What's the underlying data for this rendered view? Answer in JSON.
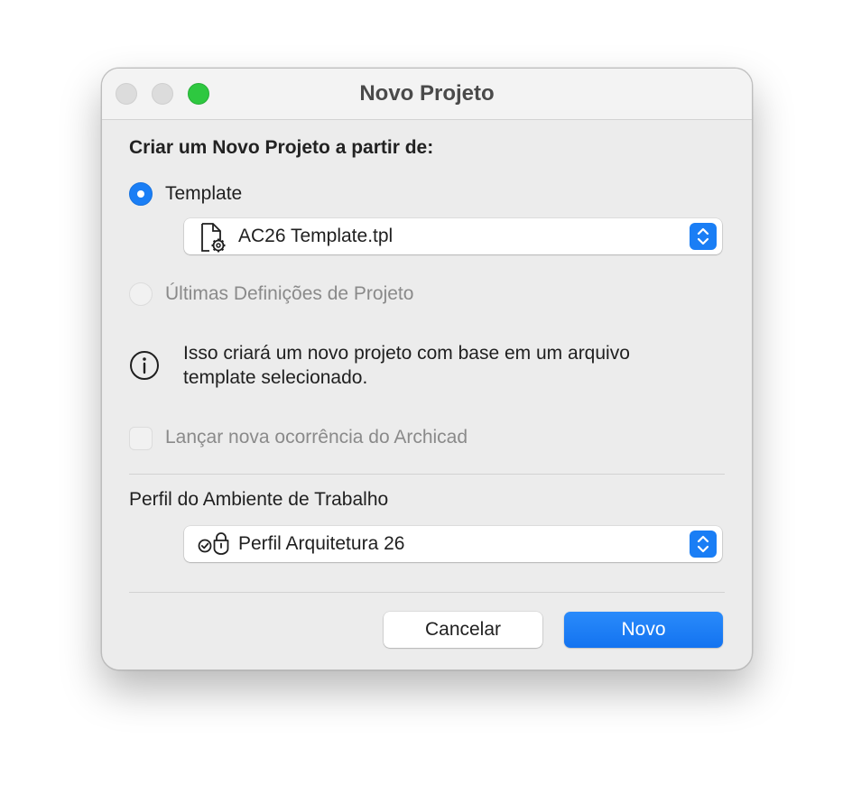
{
  "window": {
    "title": "Novo Projeto"
  },
  "source": {
    "heading": "Criar um Novo Projeto a partir de:",
    "template_option": {
      "label": "Template",
      "selected": true
    },
    "template_popup": {
      "value": "AC26 Template.tpl",
      "icon": "template-file-gear-icon"
    },
    "last_settings_option": {
      "label": "Últimas Definições de Projeto",
      "selected": false,
      "enabled": false
    }
  },
  "info": {
    "icon": "info-icon",
    "line1": "Isso criará um novo projeto com base em um arquivo",
    "line2": "template selecionado."
  },
  "launch_checkbox": {
    "label": "Lançar nova ocorrência do Archicad",
    "checked": false,
    "enabled": false
  },
  "work_environment": {
    "label": "Perfil do Ambiente de Trabalho",
    "popup_value": "Perfil Arquitetura 26",
    "icon": "locked-profile-check-icon"
  },
  "buttons": {
    "cancel": "Cancelar",
    "new": "Novo"
  },
  "colors": {
    "accent": "#1a7ef5",
    "zoom_button": "#2ec840"
  }
}
